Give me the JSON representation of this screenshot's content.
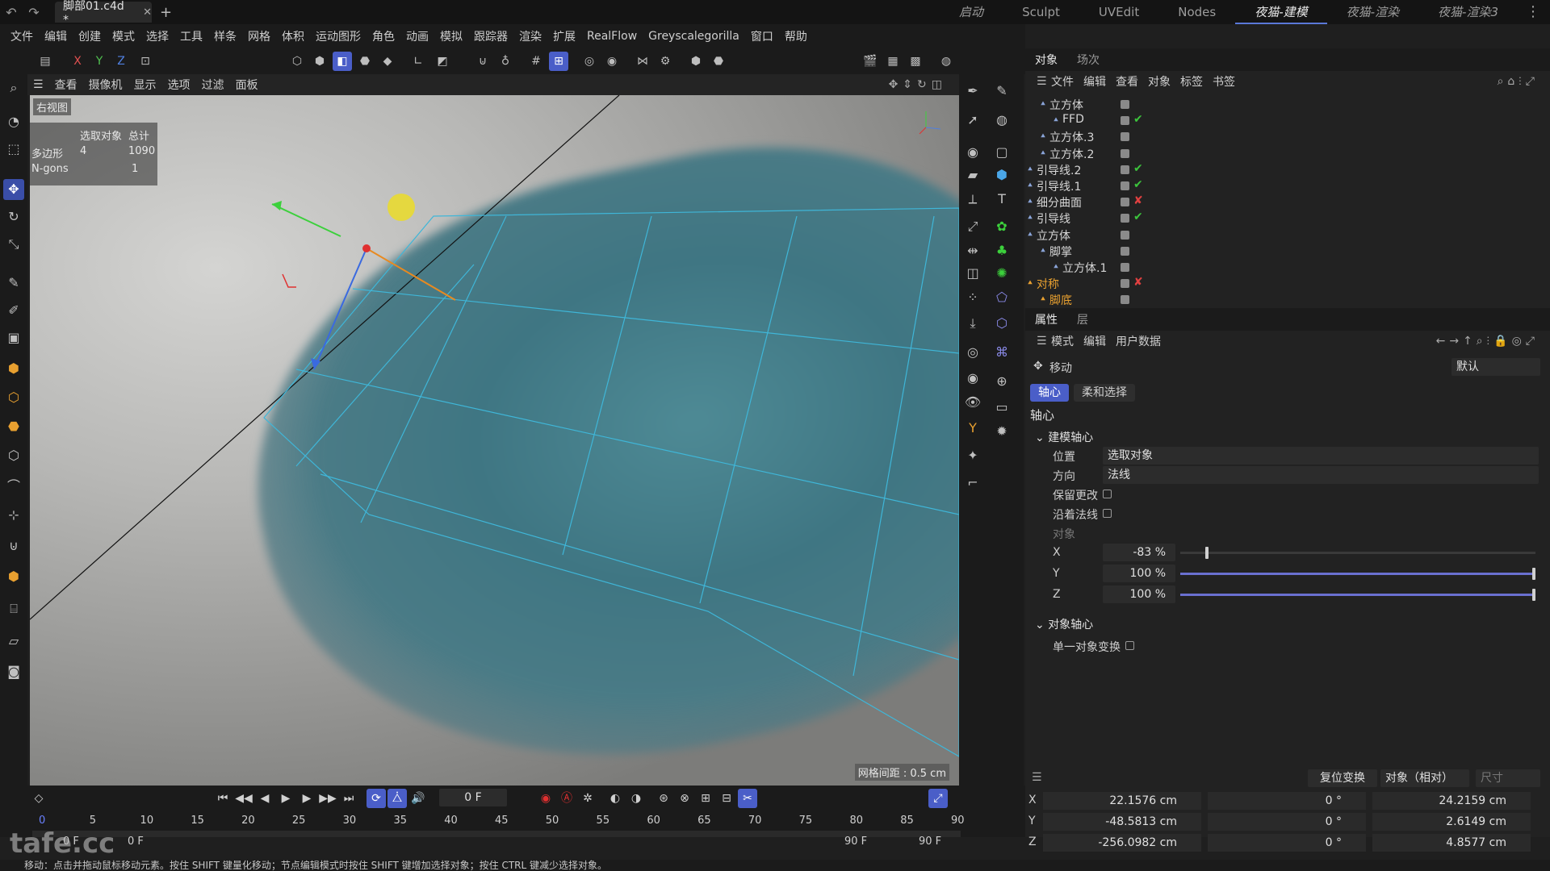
{
  "titlebar": {
    "doc_tab": "脚部01.c4d *",
    "layouts": [
      "启动",
      "Sculpt",
      "UVEdit",
      "Nodes",
      "夜猫-建模",
      "夜猫-渲染",
      "夜猫-渲染3"
    ],
    "active_layout": "夜猫-建模"
  },
  "menubar": [
    "文件",
    "编辑",
    "创建",
    "模式",
    "选择",
    "工具",
    "样条",
    "网格",
    "体积",
    "运动图形",
    "角色",
    "动画",
    "模拟",
    "跟踪器",
    "渲染",
    "扩展",
    "RealFlow",
    "Greyscalegorilla",
    "窗口",
    "帮助"
  ],
  "axis_buttons": [
    "X",
    "Y",
    "Z"
  ],
  "viewport_menu": [
    "查看",
    "摄像机",
    "显示",
    "选项",
    "过滤",
    "面板"
  ],
  "viewport": {
    "name": "右视图",
    "hud": {
      "col_selected": "选取对象",
      "col_total": "总计",
      "rows": [
        {
          "label": "多边形",
          "selected": "4",
          "total": "1090"
        },
        {
          "label": "N-gons",
          "selected": "",
          "total": "1"
        }
      ]
    },
    "grid_spacing": "网格间距 : 0.5 cm"
  },
  "object_panel": {
    "tabs": [
      "对象",
      "场次"
    ],
    "menu": [
      "文件",
      "编辑",
      "查看",
      "对象",
      "标签",
      "书签"
    ],
    "objects": [
      {
        "name": "立方体",
        "indent": 1,
        "status": ""
      },
      {
        "name": "FFD",
        "indent": 2,
        "status": "check"
      },
      {
        "name": "立方体.3",
        "indent": 1,
        "status": ""
      },
      {
        "name": "立方体.2",
        "indent": 1,
        "status": ""
      },
      {
        "name": "引导线.2",
        "indent": 0,
        "status": "check"
      },
      {
        "name": "引导线.1",
        "indent": 0,
        "status": "check"
      },
      {
        "name": "细分曲面",
        "indent": 0,
        "status": "x"
      },
      {
        "name": "引导线",
        "indent": 0,
        "status": "check"
      },
      {
        "name": "立方体",
        "indent": 0,
        "status": ""
      },
      {
        "name": "脚掌",
        "indent": 1,
        "status": ""
      },
      {
        "name": "立方体.1",
        "indent": 2,
        "status": ""
      },
      {
        "name": "对称",
        "indent": 0,
        "status": "x",
        "highlight": true
      },
      {
        "name": "脚底",
        "indent": 1,
        "status": "",
        "highlight": true
      }
    ]
  },
  "attributes": {
    "tabs": [
      "属性",
      "层"
    ],
    "menu": [
      "模式",
      "编辑",
      "用户数据"
    ],
    "tool_name": "移动",
    "preset": "默认",
    "subtabs": [
      "轴心",
      "柔和选择"
    ],
    "section": "轴心",
    "group1": "建模轴心",
    "position_label": "位置",
    "position_value": "选取对象",
    "direction_label": "方向",
    "direction_value": "法线",
    "keep_changes": "保留更改",
    "along_normal": "沿着法线",
    "object_label": "对象",
    "x_label": "X",
    "x_value": "-83 %",
    "x_fraction": -0.83,
    "y_label": "Y",
    "y_value": "100 %",
    "y_fraction": 1.0,
    "z_label": "Z",
    "z_value": "100 %",
    "z_fraction": 1.0,
    "group2": "对象轴心",
    "single_object": "单一对象变换"
  },
  "coords": {
    "reset_button": "复位变换",
    "mode_select": "对象（相对）",
    "size_select": "尺寸",
    "rows": [
      {
        "axis": "X",
        "pos": "22.1576 cm",
        "rot": "0 °",
        "size": "24.2159 cm"
      },
      {
        "axis": "Y",
        "pos": "-48.5813 cm",
        "rot": "0 °",
        "size": "2.6149 cm"
      },
      {
        "axis": "Z",
        "pos": "-256.0982 cm",
        "rot": "0 °",
        "size": "4.8577 cm"
      }
    ]
  },
  "timeline": {
    "current_frame": "0 F",
    "ticks": [
      "0",
      "5",
      "10",
      "15",
      "20",
      "25",
      "30",
      "35",
      "40",
      "45",
      "50",
      "55",
      "60",
      "65",
      "70",
      "75",
      "80",
      "85",
      "90"
    ],
    "start": "0 F",
    "start2": "0 F",
    "end": "90 F",
    "end2": "90 F"
  },
  "status_text": "移动：点击并拖动鼠标移动元素。按住 SHIFT 键量化移动；节点编辑模式时按住 SHIFT 键增加选择对象；按住 CTRL 键减少选择对象。",
  "watermark": "tafe.cc"
}
